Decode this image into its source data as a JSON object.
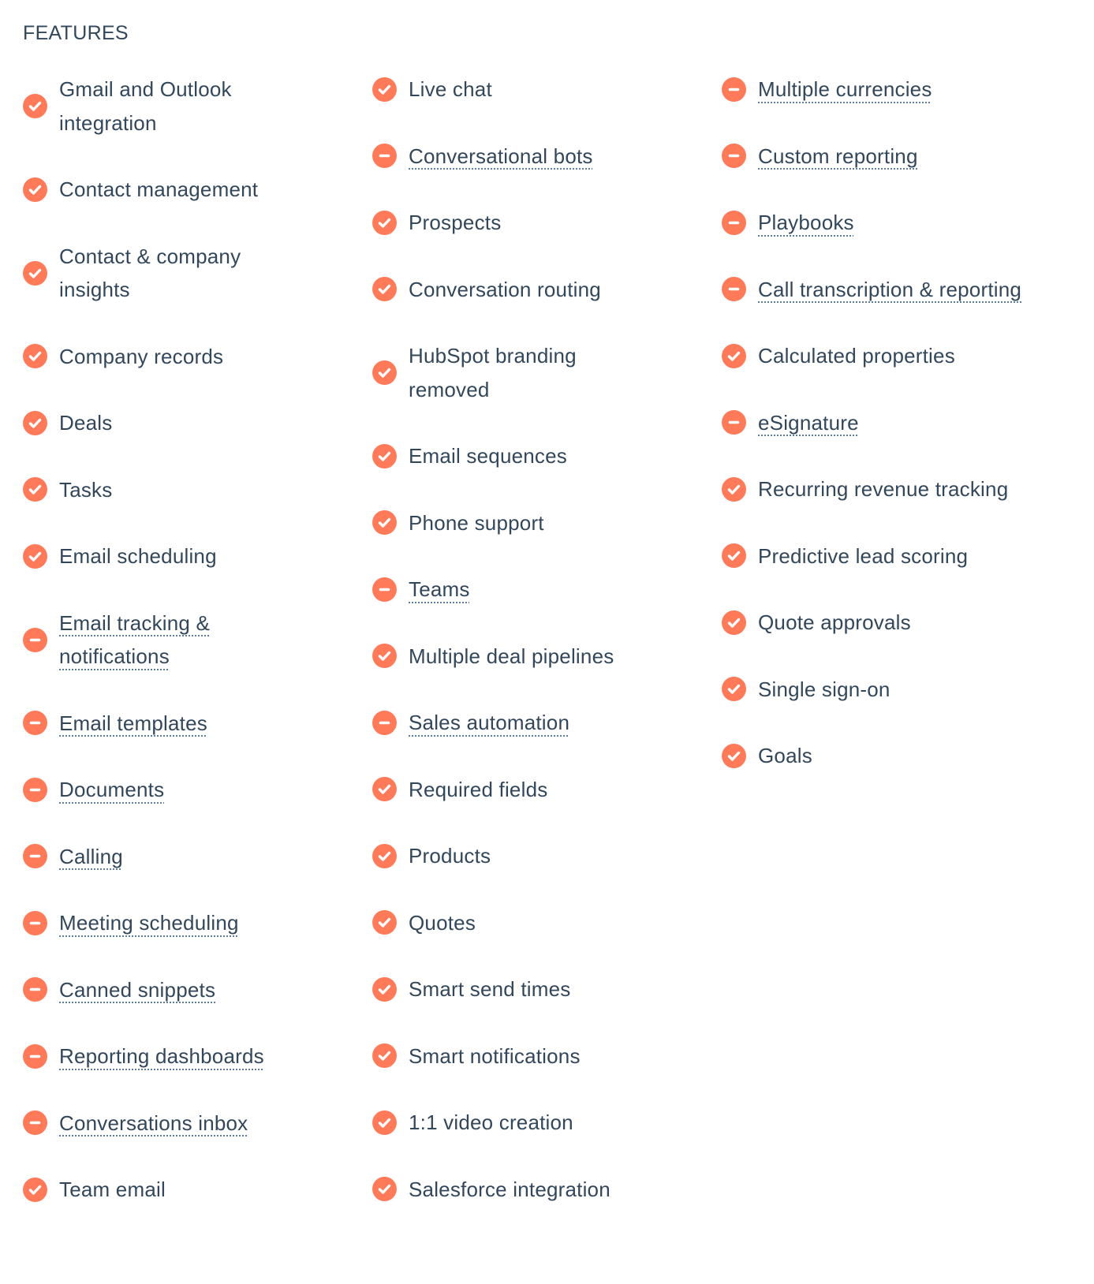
{
  "heading": "FEATURES",
  "colors": {
    "icon_bg": "#ff7a59",
    "text": "#33475b",
    "tooltip_underline": "#5c7da3"
  },
  "icon_legend": {
    "check": "check-circle-icon (included)",
    "minus": "minus-circle-icon (limited)"
  },
  "columns": [
    {
      "items": [
        {
          "label": "Gmail and Outlook integration",
          "icon": "check",
          "has_tooltip": false
        },
        {
          "label": "Contact management",
          "icon": "check",
          "has_tooltip": false
        },
        {
          "label": "Contact & company insights",
          "icon": "check",
          "has_tooltip": false
        },
        {
          "label": "Company records",
          "icon": "check",
          "has_tooltip": false
        },
        {
          "label": "Deals",
          "icon": "check",
          "has_tooltip": false
        },
        {
          "label": "Tasks",
          "icon": "check",
          "has_tooltip": false
        },
        {
          "label": "Email scheduling",
          "icon": "check",
          "has_tooltip": false
        },
        {
          "label": "Email tracking & notifications",
          "icon": "minus",
          "has_tooltip": true
        },
        {
          "label": "Email templates",
          "icon": "minus",
          "has_tooltip": true
        },
        {
          "label": "Documents",
          "icon": "minus",
          "has_tooltip": true
        },
        {
          "label": "Calling",
          "icon": "minus",
          "has_tooltip": true
        },
        {
          "label": "Meeting scheduling",
          "icon": "minus",
          "has_tooltip": true
        },
        {
          "label": "Canned snippets",
          "icon": "minus",
          "has_tooltip": true
        },
        {
          "label": "Reporting dashboards",
          "icon": "minus",
          "has_tooltip": true
        },
        {
          "label": "Conversations inbox",
          "icon": "minus",
          "has_tooltip": true
        },
        {
          "label": "Team email",
          "icon": "check",
          "has_tooltip": false
        }
      ]
    },
    {
      "items": [
        {
          "label": "Live chat",
          "icon": "check",
          "has_tooltip": false
        },
        {
          "label": "Conversational bots",
          "icon": "minus",
          "has_tooltip": true
        },
        {
          "label": "Prospects",
          "icon": "check",
          "has_tooltip": false
        },
        {
          "label": "Conversation routing",
          "icon": "check",
          "has_tooltip": false
        },
        {
          "label": "HubSpot branding removed",
          "icon": "check",
          "has_tooltip": false
        },
        {
          "label": "Email sequences",
          "icon": "check",
          "has_tooltip": false
        },
        {
          "label": "Phone support",
          "icon": "check",
          "has_tooltip": false
        },
        {
          "label": "Teams",
          "icon": "minus",
          "has_tooltip": true
        },
        {
          "label": "Multiple deal pipelines",
          "icon": "check",
          "has_tooltip": false
        },
        {
          "label": "Sales automation",
          "icon": "minus",
          "has_tooltip": true
        },
        {
          "label": "Required fields",
          "icon": "check",
          "has_tooltip": false
        },
        {
          "label": "Products",
          "icon": "check",
          "has_tooltip": false
        },
        {
          "label": "Quotes",
          "icon": "check",
          "has_tooltip": false
        },
        {
          "label": "Smart send times",
          "icon": "check",
          "has_tooltip": false
        },
        {
          "label": "Smart notifications",
          "icon": "check",
          "has_tooltip": false
        },
        {
          "label": "1:1 video creation",
          "icon": "check",
          "has_tooltip": false
        },
        {
          "label": "Salesforce integration",
          "icon": "check",
          "has_tooltip": false
        }
      ]
    },
    {
      "items": [
        {
          "label": "Multiple currencies",
          "icon": "minus",
          "has_tooltip": true
        },
        {
          "label": "Custom reporting",
          "icon": "minus",
          "has_tooltip": true
        },
        {
          "label": "Playbooks",
          "icon": "minus",
          "has_tooltip": true
        },
        {
          "label": "Call transcription & reporting",
          "icon": "minus",
          "has_tooltip": true
        },
        {
          "label": "Calculated properties",
          "icon": "check",
          "has_tooltip": false
        },
        {
          "label": "eSignature",
          "icon": "minus",
          "has_tooltip": true
        },
        {
          "label": "Recurring revenue tracking",
          "icon": "check",
          "has_tooltip": false
        },
        {
          "label": "Predictive lead scoring",
          "icon": "check",
          "has_tooltip": false
        },
        {
          "label": "Quote approvals",
          "icon": "check",
          "has_tooltip": false
        },
        {
          "label": "Single sign-on",
          "icon": "check",
          "has_tooltip": false
        },
        {
          "label": "Goals",
          "icon": "check",
          "has_tooltip": false
        }
      ]
    }
  ]
}
